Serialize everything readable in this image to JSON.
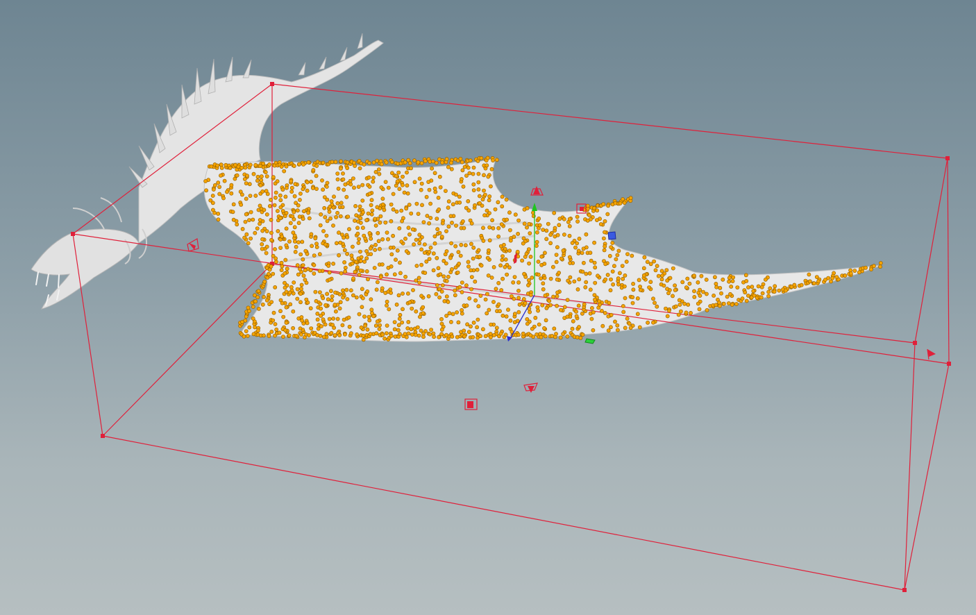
{
  "viewport": {
    "label": "",
    "background_top": "#6e8592",
    "background_bottom": "#b6bfc1"
  },
  "colors": {
    "bounding_box": "#e0203a",
    "points": "#f5a300",
    "point_outline": "#8a5a00",
    "mesh": "#e6e6e6",
    "mesh_shade": "#c9c9c9",
    "axis_x": "#1b2fd6",
    "axis_y": "#1ec51e",
    "axis_z": "#2a2fd0"
  },
  "scene": {
    "model": "dragon-mesh",
    "point_cloud": "wing-scatter-points",
    "bounding_box": "red-wireframe-box",
    "handles": [
      "handle-top",
      "handle-left",
      "handle-right",
      "handle-front",
      "handle-bottom-a",
      "handle-bottom-b",
      "handle-blue",
      "handle-green"
    ]
  }
}
